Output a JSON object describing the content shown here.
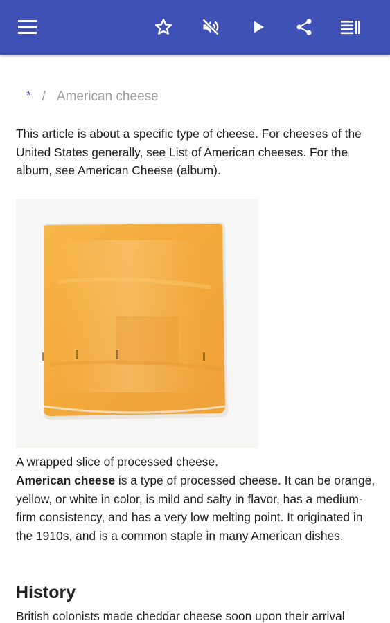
{
  "toolbar": {
    "menu_icon": "menu-icon",
    "bookmark_icon": "star-outline-icon",
    "mute_icon": "volume-off-icon",
    "play_icon": "play-icon",
    "share_icon": "share-icon",
    "toc_icon": "list-icon",
    "color": "#3f51b5"
  },
  "breadcrumb": {
    "home": "*",
    "separator": "/",
    "current": "American cheese"
  },
  "article": {
    "hatnote": "This article is about a specific type of cheese. For cheeses of the United States generally, see List of American cheeses. For the album, see American Cheese (album).",
    "image_caption": "A wrapped slice of processed cheese.",
    "lead_bold": "American cheese",
    "lead_rest": " is a type of processed cheese. It can be orange, yellow, or white in color, is mild and salty in flavor, has a medium-firm consistency, and has a very low melting point. It originated in the 1910s, and is a common staple in many American dishes.",
    "history_heading": "History",
    "history_text": "British colonists made cheddar cheese soon upon their arrival"
  }
}
